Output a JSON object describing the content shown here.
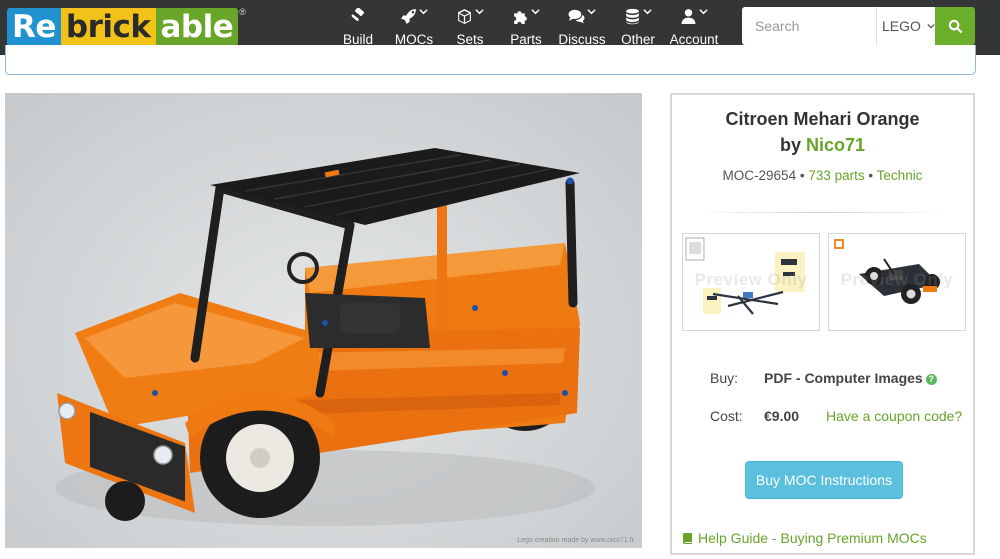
{
  "logo": {
    "part1": "Re",
    "part2": "brick",
    "part3": "able",
    "mark": "®"
  },
  "nav": [
    {
      "label": "Build",
      "icon": "gavel-icon"
    },
    {
      "label": "MOCs",
      "icon": "rocket-icon"
    },
    {
      "label": "Sets",
      "icon": "cube-icon"
    },
    {
      "label": "Parts",
      "icon": "puzzle-icon"
    },
    {
      "label": "Discuss",
      "icon": "comments-icon"
    },
    {
      "label": "Other",
      "icon": "database-icon"
    },
    {
      "label": "Account",
      "icon": "user-icon"
    }
  ],
  "search": {
    "placeholder": "Search",
    "value": "",
    "scope": "LEGO"
  },
  "photo": {
    "credit": "Lego creation made by www.nico71.fr"
  },
  "moc": {
    "title": "Citroen Mehari Orange",
    "by_prefix": "by",
    "author": "Nico71",
    "id": "MOC-29654",
    "sep": "•",
    "parts": "733 parts",
    "theme": "Technic"
  },
  "thumbs": {
    "watermark": "Preview Only"
  },
  "purchase": {
    "buy_label": "Buy:",
    "buy_value": "PDF - Computer Images",
    "help_mark": "?",
    "cost_label": "Cost:",
    "cost_value": "€9.00",
    "coupon_link": "Have a coupon code?",
    "button": "Buy MOC Instructions",
    "help_guide": "Help Guide - Buying Premium MOCs"
  },
  "colors": {
    "brand_green": "#67a52a",
    "nav_bg": "#333537",
    "info_button": "#5bc0de",
    "lego_orange": "#f27b13"
  }
}
